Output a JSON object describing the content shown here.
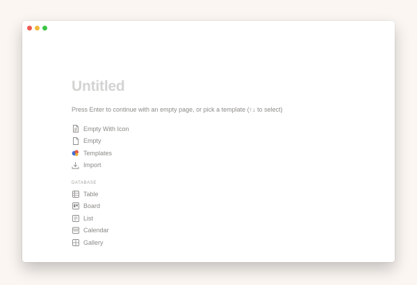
{
  "page": {
    "title": "Untitled",
    "hint": "Press Enter to continue with an empty page, or pick a template (↑↓ to select)"
  },
  "options": [
    {
      "label": "Empty With Icon",
      "icon": "page-with-icon-icon"
    },
    {
      "label": "Empty",
      "icon": "page-icon"
    },
    {
      "label": "Templates",
      "icon": "templates-icon"
    },
    {
      "label": "Import",
      "icon": "import-icon"
    }
  ],
  "database": {
    "section_label": "DATABASE",
    "items": [
      {
        "label": "Table",
        "icon": "table-icon"
      },
      {
        "label": "Board",
        "icon": "board-icon"
      },
      {
        "label": "List",
        "icon": "list-icon"
      },
      {
        "label": "Calendar",
        "icon": "calendar-icon"
      },
      {
        "label": "Gallery",
        "icon": "gallery-icon"
      }
    ]
  },
  "colors": {
    "close": "#ec5a50",
    "minimize": "#f1b93b",
    "maximize": "#3cc443"
  }
}
